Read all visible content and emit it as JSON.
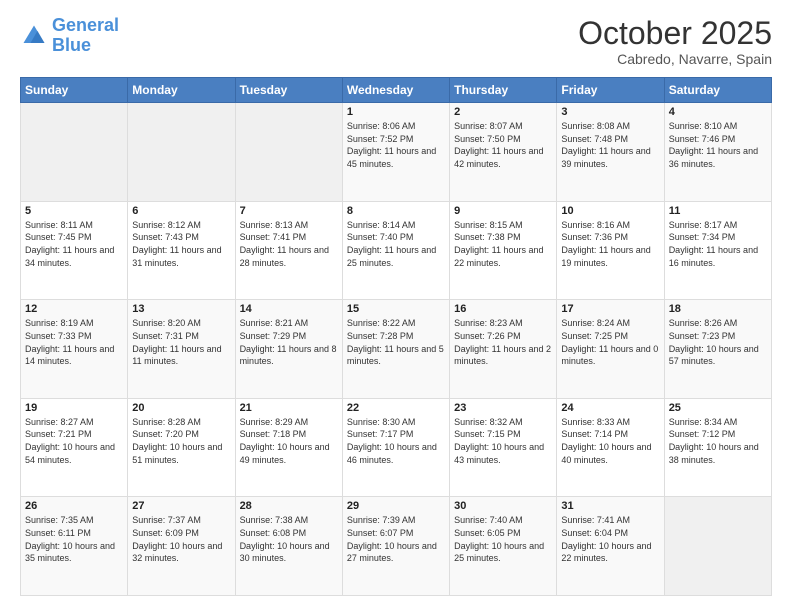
{
  "header": {
    "logo": {
      "line1": "General",
      "line2": "Blue"
    },
    "title": "October 2025",
    "location": "Cabredo, Navarre, Spain"
  },
  "weekdays": [
    "Sunday",
    "Monday",
    "Tuesday",
    "Wednesday",
    "Thursday",
    "Friday",
    "Saturday"
  ],
  "weeks": [
    [
      null,
      null,
      null,
      {
        "day": 1,
        "sunrise": "8:06 AM",
        "sunset": "7:52 PM",
        "daylight": "11 hours and 45 minutes."
      },
      {
        "day": 2,
        "sunrise": "8:07 AM",
        "sunset": "7:50 PM",
        "daylight": "11 hours and 42 minutes."
      },
      {
        "day": 3,
        "sunrise": "8:08 AM",
        "sunset": "7:48 PM",
        "daylight": "11 hours and 39 minutes."
      },
      {
        "day": 4,
        "sunrise": "8:10 AM",
        "sunset": "7:46 PM",
        "daylight": "11 hours and 36 minutes."
      }
    ],
    [
      {
        "day": 5,
        "sunrise": "8:11 AM",
        "sunset": "7:45 PM",
        "daylight": "11 hours and 34 minutes."
      },
      {
        "day": 6,
        "sunrise": "8:12 AM",
        "sunset": "7:43 PM",
        "daylight": "11 hours and 31 minutes."
      },
      {
        "day": 7,
        "sunrise": "8:13 AM",
        "sunset": "7:41 PM",
        "daylight": "11 hours and 28 minutes."
      },
      {
        "day": 8,
        "sunrise": "8:14 AM",
        "sunset": "7:40 PM",
        "daylight": "11 hours and 25 minutes."
      },
      {
        "day": 9,
        "sunrise": "8:15 AM",
        "sunset": "7:38 PM",
        "daylight": "11 hours and 22 minutes."
      },
      {
        "day": 10,
        "sunrise": "8:16 AM",
        "sunset": "7:36 PM",
        "daylight": "11 hours and 19 minutes."
      },
      {
        "day": 11,
        "sunrise": "8:17 AM",
        "sunset": "7:34 PM",
        "daylight": "11 hours and 16 minutes."
      }
    ],
    [
      {
        "day": 12,
        "sunrise": "8:19 AM",
        "sunset": "7:33 PM",
        "daylight": "11 hours and 14 minutes."
      },
      {
        "day": 13,
        "sunrise": "8:20 AM",
        "sunset": "7:31 PM",
        "daylight": "11 hours and 11 minutes."
      },
      {
        "day": 14,
        "sunrise": "8:21 AM",
        "sunset": "7:29 PM",
        "daylight": "11 hours and 8 minutes."
      },
      {
        "day": 15,
        "sunrise": "8:22 AM",
        "sunset": "7:28 PM",
        "daylight": "11 hours and 5 minutes."
      },
      {
        "day": 16,
        "sunrise": "8:23 AM",
        "sunset": "7:26 PM",
        "daylight": "11 hours and 2 minutes."
      },
      {
        "day": 17,
        "sunrise": "8:24 AM",
        "sunset": "7:25 PM",
        "daylight": "11 hours and 0 minutes."
      },
      {
        "day": 18,
        "sunrise": "8:26 AM",
        "sunset": "7:23 PM",
        "daylight": "10 hours and 57 minutes."
      }
    ],
    [
      {
        "day": 19,
        "sunrise": "8:27 AM",
        "sunset": "7:21 PM",
        "daylight": "10 hours and 54 minutes."
      },
      {
        "day": 20,
        "sunrise": "8:28 AM",
        "sunset": "7:20 PM",
        "daylight": "10 hours and 51 minutes."
      },
      {
        "day": 21,
        "sunrise": "8:29 AM",
        "sunset": "7:18 PM",
        "daylight": "10 hours and 49 minutes."
      },
      {
        "day": 22,
        "sunrise": "8:30 AM",
        "sunset": "7:17 PM",
        "daylight": "10 hours and 46 minutes."
      },
      {
        "day": 23,
        "sunrise": "8:32 AM",
        "sunset": "7:15 PM",
        "daylight": "10 hours and 43 minutes."
      },
      {
        "day": 24,
        "sunrise": "8:33 AM",
        "sunset": "7:14 PM",
        "daylight": "10 hours and 40 minutes."
      },
      {
        "day": 25,
        "sunrise": "8:34 AM",
        "sunset": "7:12 PM",
        "daylight": "10 hours and 38 minutes."
      }
    ],
    [
      {
        "day": 26,
        "sunrise": "7:35 AM",
        "sunset": "6:11 PM",
        "daylight": "10 hours and 35 minutes."
      },
      {
        "day": 27,
        "sunrise": "7:37 AM",
        "sunset": "6:09 PM",
        "daylight": "10 hours and 32 minutes."
      },
      {
        "day": 28,
        "sunrise": "7:38 AM",
        "sunset": "6:08 PM",
        "daylight": "10 hours and 30 minutes."
      },
      {
        "day": 29,
        "sunrise": "7:39 AM",
        "sunset": "6:07 PM",
        "daylight": "10 hours and 27 minutes."
      },
      {
        "day": 30,
        "sunrise": "7:40 AM",
        "sunset": "6:05 PM",
        "daylight": "10 hours and 25 minutes."
      },
      {
        "day": 31,
        "sunrise": "7:41 AM",
        "sunset": "6:04 PM",
        "daylight": "10 hours and 22 minutes."
      },
      null
    ]
  ]
}
